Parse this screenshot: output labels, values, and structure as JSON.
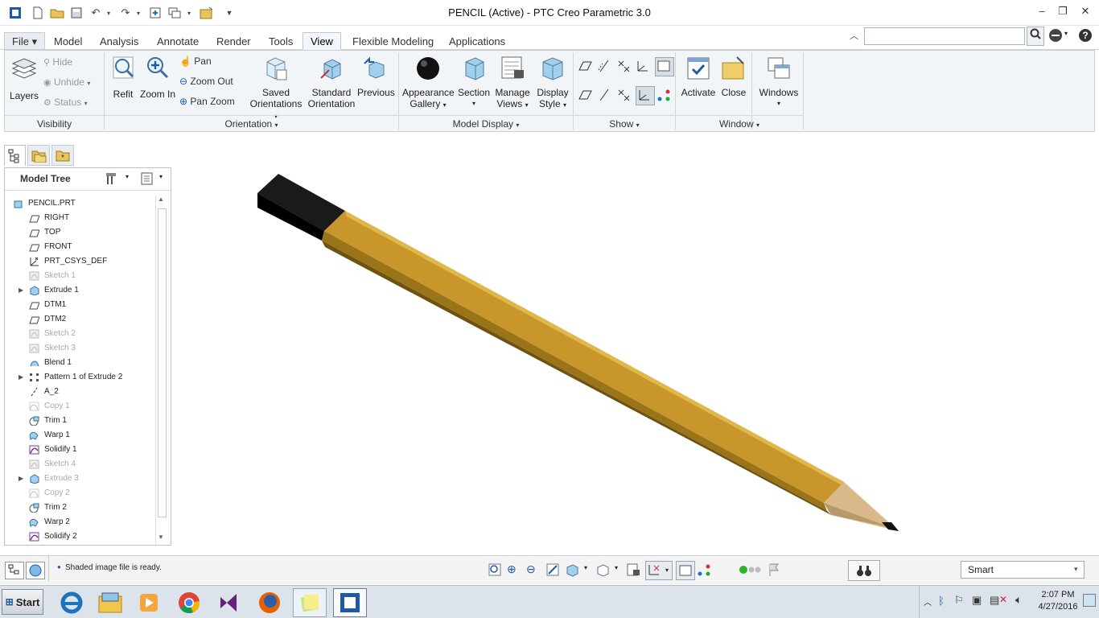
{
  "window": {
    "title": "PENCIL (Active) - PTC Creo Parametric 3.0"
  },
  "tabs": [
    "File",
    "Model",
    "Analysis",
    "Annotate",
    "Render",
    "Tools",
    "View",
    "Flexible Modeling",
    "Applications"
  ],
  "active_tab": "View",
  "search": {
    "value": "",
    "placeholder": ""
  },
  "ribbon": {
    "visibility": {
      "layers": "Layers",
      "hide": "Hide",
      "unhide": "Unhide",
      "status": "Status",
      "group": "Visibility"
    },
    "orientation": {
      "refit": "Refit",
      "zoom_in": "Zoom In",
      "pan": "Pan",
      "zoom_out": "Zoom Out",
      "pan_zoom": "Pan Zoom",
      "saved1": "Saved",
      "saved2": "Orientations",
      "standard1": "Standard",
      "standard2": "Orientation",
      "previous": "Previous",
      "group": "Orientation"
    },
    "model_display": {
      "appearance1": "Appearance",
      "appearance2": "Gallery",
      "section": "Section",
      "manage1": "Manage",
      "manage2": "Views",
      "display1": "Display",
      "display2": "Style",
      "group": "Model Display"
    },
    "show": {
      "group": "Show"
    },
    "window": {
      "activate": "Activate",
      "close": "Close",
      "windows": "Windows",
      "group": "Window"
    }
  },
  "panel_tabs": [
    "model-tree",
    "folder-browser",
    "favorites"
  ],
  "model_tree": {
    "title": "Model Tree",
    "items": [
      {
        "label": "PENCIL.PRT",
        "icon": "part-icon",
        "dim": false,
        "expandable": false
      },
      {
        "label": "RIGHT",
        "icon": "datum-plane-icon",
        "dim": false,
        "expandable": false
      },
      {
        "label": "TOP",
        "icon": "datum-plane-icon",
        "dim": false,
        "expandable": false
      },
      {
        "label": "FRONT",
        "icon": "datum-plane-icon",
        "dim": false,
        "expandable": false
      },
      {
        "label": "PRT_CSYS_DEF",
        "icon": "csys-icon",
        "dim": false,
        "expandable": false
      },
      {
        "label": "Sketch 1",
        "icon": "sketch-icon",
        "dim": true,
        "expandable": false
      },
      {
        "label": "Extrude 1",
        "icon": "extrude-icon",
        "dim": false,
        "expandable": true
      },
      {
        "label": "DTM1",
        "icon": "datum-plane-icon",
        "dim": false,
        "expandable": false
      },
      {
        "label": "DTM2",
        "icon": "datum-plane-icon",
        "dim": false,
        "expandable": false
      },
      {
        "label": "Sketch 2",
        "icon": "sketch-icon",
        "dim": true,
        "expandable": false
      },
      {
        "label": "Sketch 3",
        "icon": "sketch-icon",
        "dim": true,
        "expandable": false
      },
      {
        "label": "Blend 1",
        "icon": "blend-icon",
        "dim": false,
        "expandable": false
      },
      {
        "label": "Pattern 1 of Extrude 2",
        "icon": "pattern-icon",
        "dim": false,
        "expandable": true
      },
      {
        "label": "A_2",
        "icon": "axis-icon",
        "dim": false,
        "expandable": false
      },
      {
        "label": "Copy 1",
        "icon": "copy-icon",
        "dim": true,
        "expandable": false
      },
      {
        "label": "Trim 1",
        "icon": "trim-icon",
        "dim": false,
        "expandable": false
      },
      {
        "label": "Warp 1",
        "icon": "warp-icon",
        "dim": false,
        "expandable": false
      },
      {
        "label": "Solidify 1",
        "icon": "solidify-icon",
        "dim": false,
        "expandable": false
      },
      {
        "label": "Sketch 4",
        "icon": "sketch-icon",
        "dim": true,
        "expandable": false
      },
      {
        "label": "Extrude 3",
        "icon": "extrude-icon",
        "dim": true,
        "expandable": true
      },
      {
        "label": "Copy 2",
        "icon": "copy-icon",
        "dim": true,
        "expandable": false
      },
      {
        "label": "Trim 2",
        "icon": "trim-icon",
        "dim": false,
        "expandable": false
      },
      {
        "label": "Warp 2",
        "icon": "warp-icon",
        "dim": false,
        "expandable": false
      },
      {
        "label": "Solidify 2",
        "icon": "solidify-icon",
        "dim": false,
        "expandable": false
      }
    ]
  },
  "status": {
    "message": "Shaded image file is ready.",
    "filter": "Smart"
  },
  "taskbar": {
    "start": "Start",
    "apps": [
      "internet-explorer-icon",
      "file-explorer-icon",
      "media-player-icon",
      "chrome-icon",
      "visual-studio-icon",
      "firefox-icon",
      "sticky-notes-icon",
      "creo-icon"
    ],
    "time": "2:07 PM",
    "date": "4/27/2016"
  },
  "colors": {
    "pencil_body": "#C8962A",
    "pencil_dark": "#7A5A10",
    "eraser": "#0a0a0a",
    "wood": "#D9B98A",
    "accent": "#1e73be"
  }
}
